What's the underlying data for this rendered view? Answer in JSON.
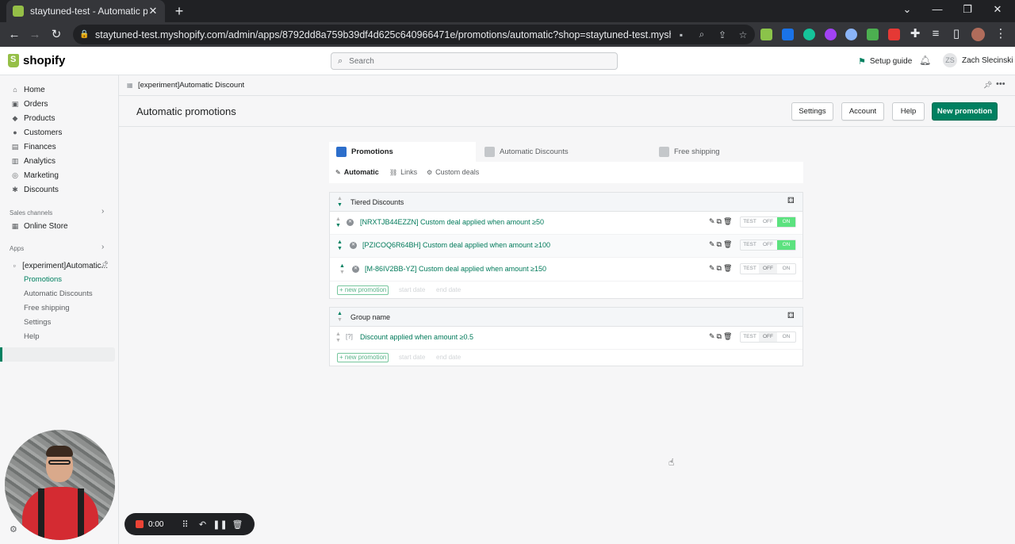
{
  "browser": {
    "tab_title": "staytuned-test - Automatic prom",
    "url": "staytuned-test.myshopify.com/admin/apps/8792dd8a759b39df4d625c640966471e/promotions/automatic?shop=staytuned-test.myshopif..."
  },
  "shopify": {
    "logo_text": "shopify",
    "search_placeholder": "Search",
    "setup_guide": "Setup guide",
    "user_initials": "ZS",
    "user_name": "Zach Slecinski"
  },
  "sidebar": {
    "items": [
      {
        "label": "Home",
        "icon": "home-icon"
      },
      {
        "label": "Orders",
        "icon": "orders-icon"
      },
      {
        "label": "Products",
        "icon": "products-icon"
      },
      {
        "label": "Customers",
        "icon": "customers-icon"
      },
      {
        "label": "Finances",
        "icon": "finances-icon"
      },
      {
        "label": "Analytics",
        "icon": "analytics-icon"
      },
      {
        "label": "Marketing",
        "icon": "marketing-icon"
      },
      {
        "label": "Discounts",
        "icon": "discounts-icon"
      }
    ],
    "sales_channels_heading": "Sales channels",
    "online_store": "Online Store",
    "apps_heading": "Apps",
    "app_name": "[experiment]Automatic...",
    "app_subitems": [
      "Promotions",
      "Automatic Discounts",
      "Free shipping",
      "Settings",
      "Help"
    ],
    "active_subitem": "Promotions"
  },
  "main": {
    "breadcrumb": "[experiment]Automatic Discount",
    "page_title": "Automatic promotions",
    "buttons": {
      "settings": "Settings",
      "account": "Account",
      "help": "Help",
      "new_promotion": "New promotion"
    },
    "tabs": [
      "Promotions",
      "Automatic Discounts",
      "Free shipping"
    ],
    "active_tab": "Promotions",
    "subtabs": [
      "Automatic",
      "Links",
      "Custom deals"
    ],
    "active_subtab": "Automatic",
    "toggle_labels": [
      "TEST",
      "OFF",
      "ON"
    ],
    "new_promotion_link": "+ new promotion",
    "start_date_label": "start date",
    "end_date_label": "end date",
    "groups": [
      {
        "name": "Tiered Discounts",
        "promotions": [
          {
            "text": "[NRXTJB44EZZN] Custom deal applied when amount ≥50",
            "state": "ON"
          },
          {
            "text": "[PZICOQ6R64BH] Custom deal applied when amount ≥100",
            "state": "ON"
          },
          {
            "text": "[M-86IV2BB-YZ] Custom deal applied when amount ≥150",
            "state": "OFF"
          }
        ]
      },
      {
        "name": "Group name",
        "promotions": [
          {
            "text": "Discount applied when amount ≥0.5",
            "state": "OFF",
            "status_marker": "[?]"
          }
        ]
      }
    ]
  },
  "recorder": {
    "time": "0:00"
  },
  "colors": {
    "shopify_green": "#008060",
    "toggle_on": "#5ce27f",
    "link_green": "#007a5a"
  }
}
